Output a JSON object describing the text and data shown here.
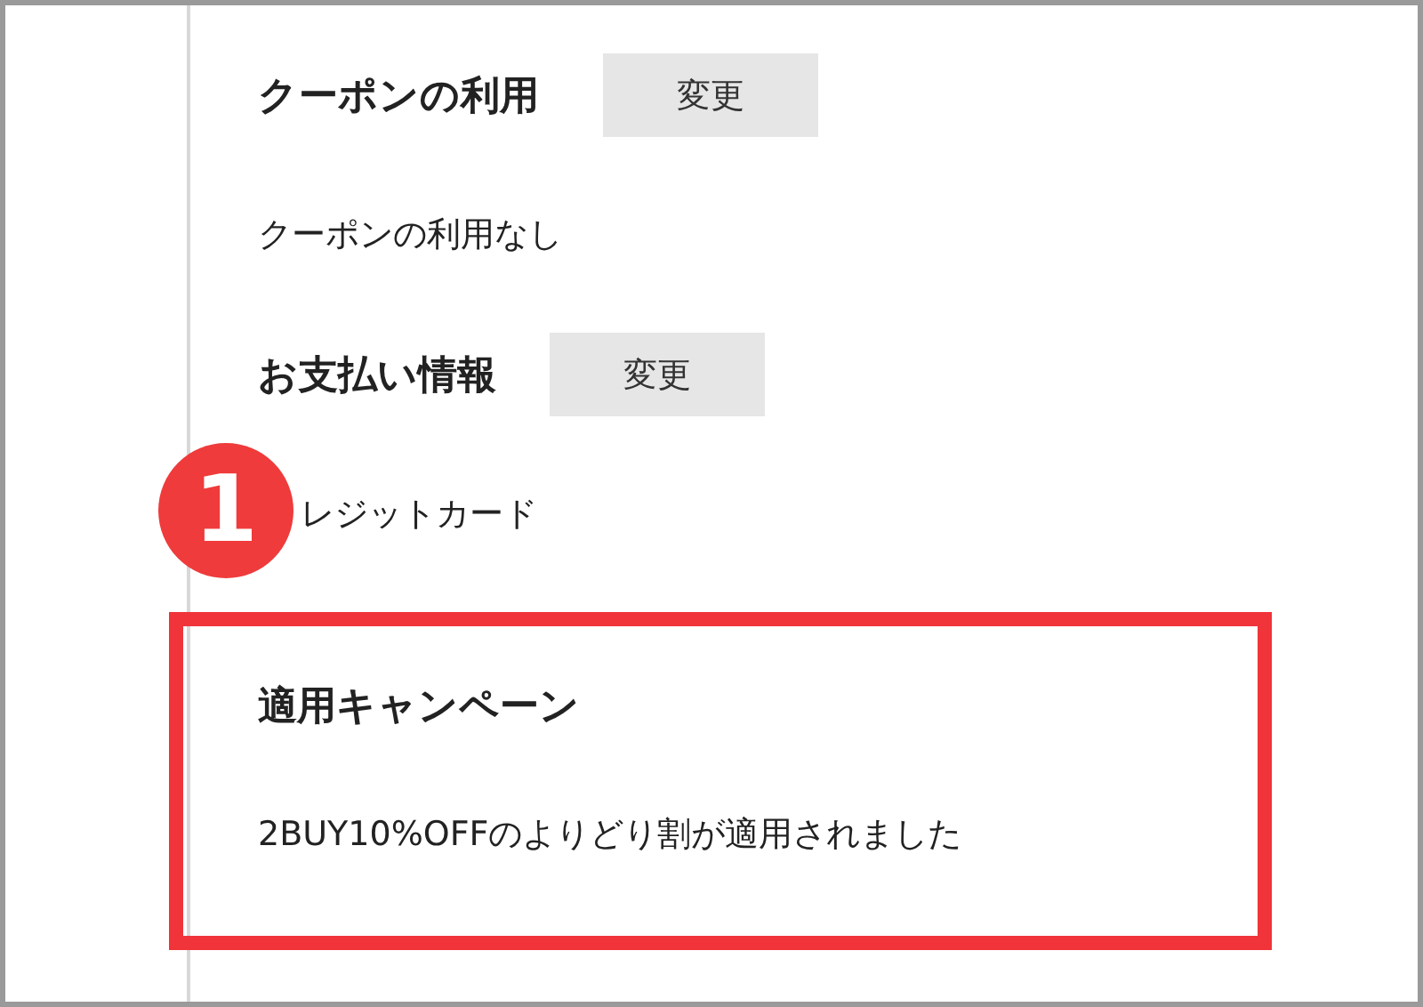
{
  "sections": [
    {
      "heading": "クーポンの利用",
      "button": "変更",
      "value": "クーポンの利用なし"
    },
    {
      "heading": "お支払い情報",
      "button": "変更",
      "value": "レジットカード",
      "badge": "1"
    }
  ],
  "campaign": {
    "heading": "適用キャンペーン",
    "text": "2BUY10%OFFのよりどり割が適用されました"
  }
}
